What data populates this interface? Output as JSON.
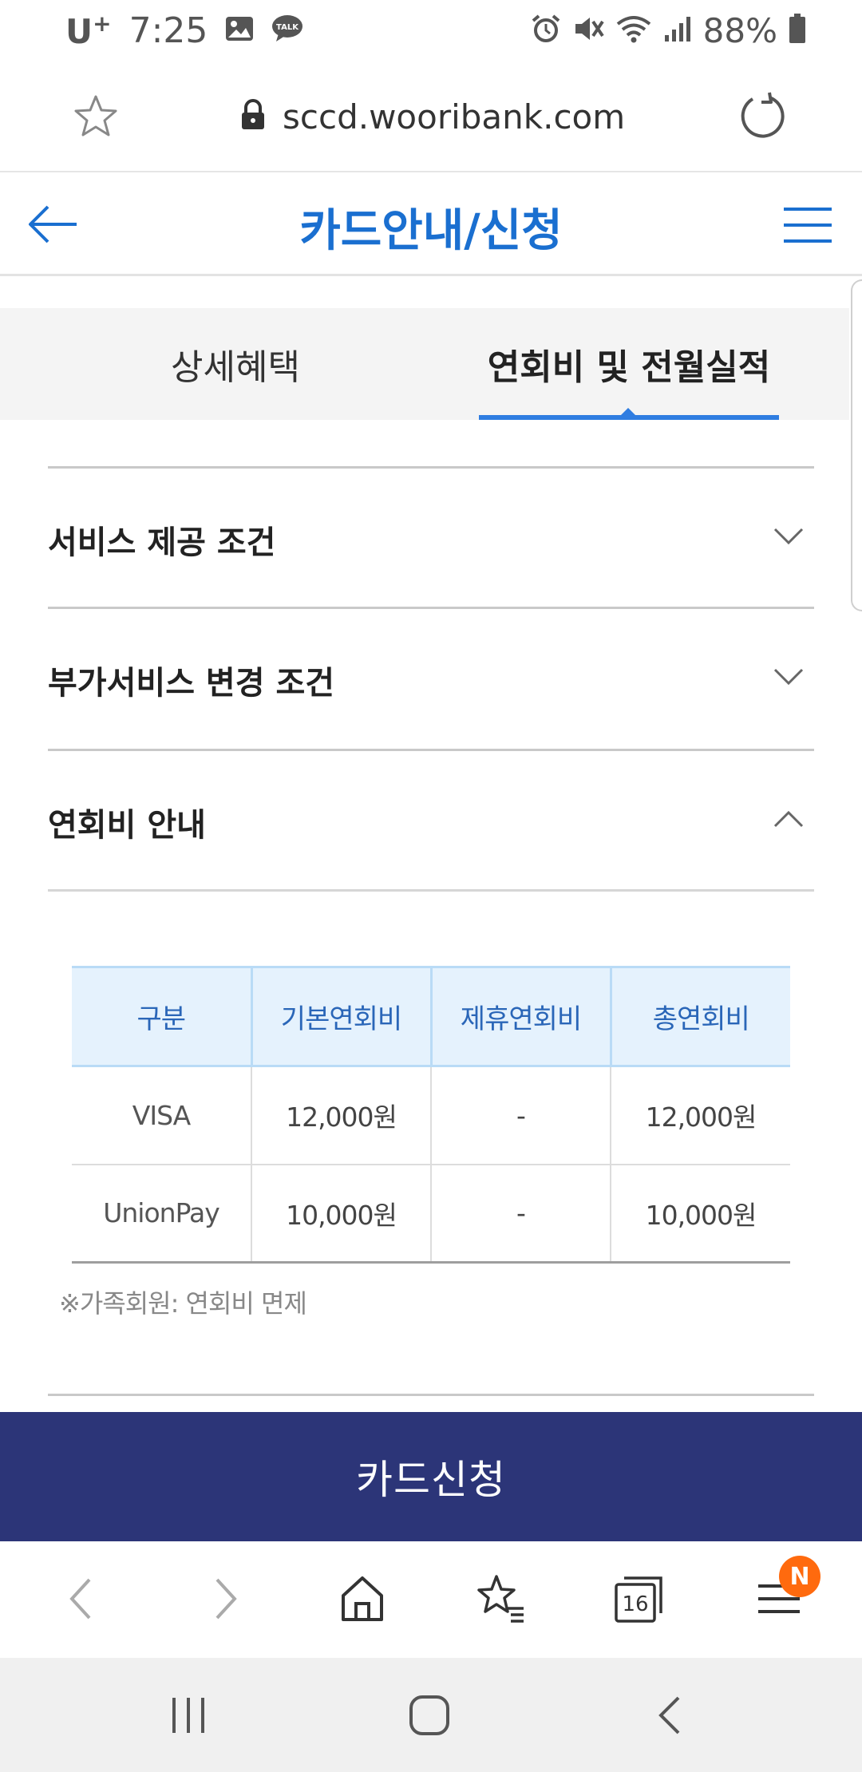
{
  "status_bar": {
    "carrier": "U",
    "carrier_sup": "+",
    "time": "7:25",
    "battery": "88%",
    "icons": [
      "gallery-icon",
      "talk-icon",
      "alarm-icon",
      "mute-icon",
      "wifi-icon",
      "signal-icon",
      "battery-icon"
    ]
  },
  "address_bar": {
    "url": "sccd.wooribank.com",
    "icons": [
      "star-icon",
      "lock-icon",
      "reload-icon"
    ]
  },
  "header": {
    "title": "카드안내/신청",
    "icons": [
      "back-arrow-icon",
      "hamburger-menu-icon"
    ],
    "accent_color": "#1a6fd0"
  },
  "tabs": [
    {
      "label": "상세혜택",
      "active": false
    },
    {
      "label": "연회비 및 전월실적",
      "active": true
    }
  ],
  "accordions": [
    {
      "title": "서비스 제공 조건",
      "expanded": false
    },
    {
      "title": "부가서비스 변경 조건",
      "expanded": false
    },
    {
      "title": "연회비 안내",
      "expanded": true
    }
  ],
  "fee_table": {
    "headers": [
      "구분",
      "기본연회비",
      "제휴연회비",
      "총연회비"
    ],
    "rows": [
      [
        "VISA",
        "12,000원",
        "-",
        "12,000원"
      ],
      [
        "UnionPay",
        "10,000원",
        "-",
        "10,000원"
      ]
    ]
  },
  "note": "※가족회원: 연회비 면제",
  "apply_button": {
    "label": "카드신청",
    "color": "#2c3578"
  },
  "browser_toolbar": {
    "tab_count": "16",
    "notification_badge": "N",
    "badge_color": "#ff6a0e",
    "icons": [
      "back-icon",
      "forward-icon",
      "home-icon",
      "bookmarks-icon",
      "tabs-icon",
      "menu-icon"
    ]
  },
  "nav_bar": {
    "icons": [
      "recents-icon",
      "home-icon",
      "back-icon"
    ]
  }
}
